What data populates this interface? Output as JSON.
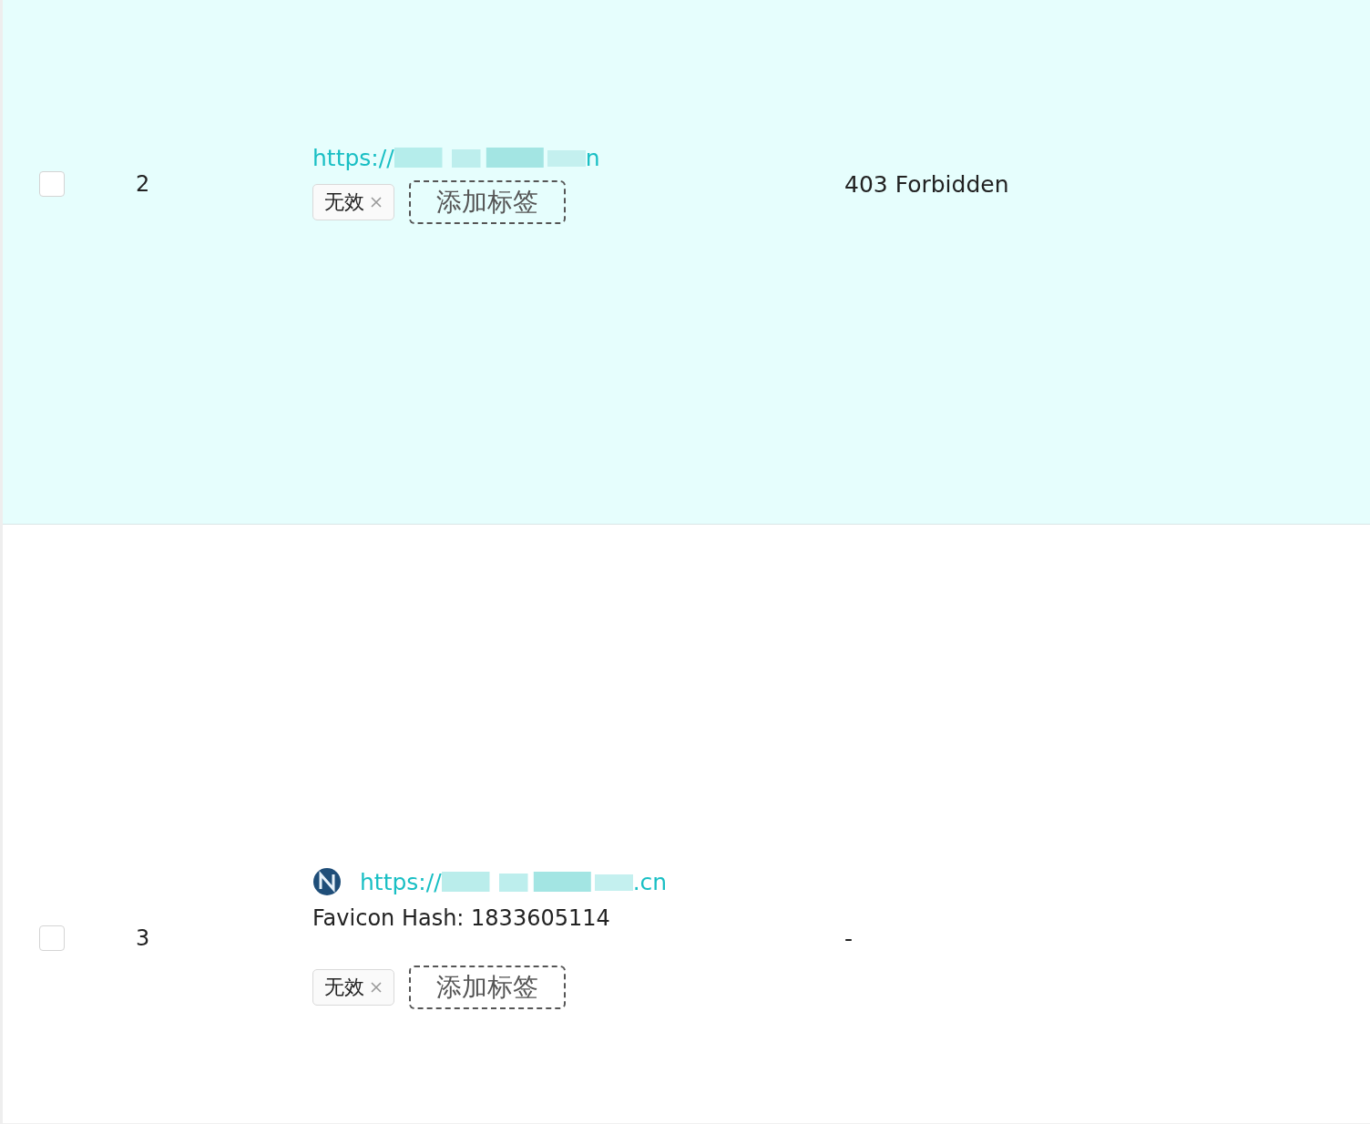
{
  "rows": [
    {
      "index": "2",
      "selected": true,
      "checked": false,
      "url_prefix": "https://",
      "url_suffix": "n",
      "favicon": false,
      "tags": [
        {
          "label": "无效",
          "closable": true
        }
      ],
      "add_tag": "添加标签",
      "title": "403 Forbidden"
    },
    {
      "index": "3",
      "selected": false,
      "checked": false,
      "url_prefix": "https://",
      "url_suffix": ".cn",
      "favicon": true,
      "hash": "Favicon Hash: 1833605114",
      "tags": [
        {
          "label": "无效",
          "closable": true
        }
      ],
      "add_tag": "添加标签",
      "title": "-"
    }
  ]
}
